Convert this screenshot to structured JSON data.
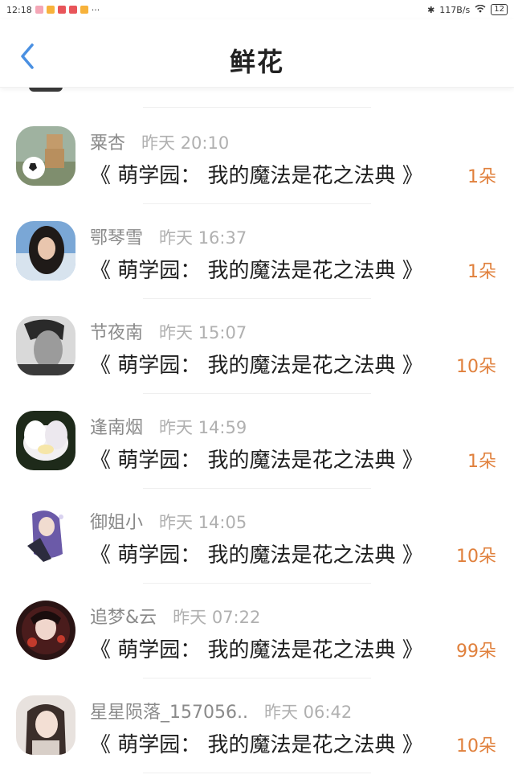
{
  "status_bar": {
    "time": "12:18",
    "extra": "···",
    "network_speed": "117B/s",
    "battery": "12"
  },
  "header": {
    "title": "鲜花"
  },
  "colors": {
    "amount": "#e0803c",
    "username": "#8a8a8a",
    "time": "#b0b0b0",
    "back": "#4a90e2"
  },
  "items": [
    {
      "user": "粟杏",
      "time": "昨天 20:10",
      "book": "《 萌学园： 我的魔法是花之法典 》",
      "amount": "1朵"
    },
    {
      "user": "鄂琴雪",
      "time": "昨天 16:37",
      "book": "《 萌学园： 我的魔法是花之法典 》",
      "amount": "1朵"
    },
    {
      "user": "节夜南",
      "time": "昨天 15:07",
      "book": "《 萌学园： 我的魔法是花之法典 》",
      "amount": "10朵"
    },
    {
      "user": "逢南烟",
      "time": "昨天 14:59",
      "book": "《 萌学园： 我的魔法是花之法典 》",
      "amount": "1朵"
    },
    {
      "user": "御姐小",
      "time": "昨天 14:05",
      "book": "《 萌学园： 我的魔法是花之法典 》",
      "amount": "10朵"
    },
    {
      "user": "追梦&云",
      "time": "昨天 07:22",
      "book": "《 萌学园： 我的魔法是花之法典 》",
      "amount": "99朵"
    },
    {
      "user": "星星陨落_157056..",
      "time": "昨天 06:42",
      "book": "《 萌学园： 我的魔法是花之法典 》",
      "amount": "10朵"
    }
  ]
}
